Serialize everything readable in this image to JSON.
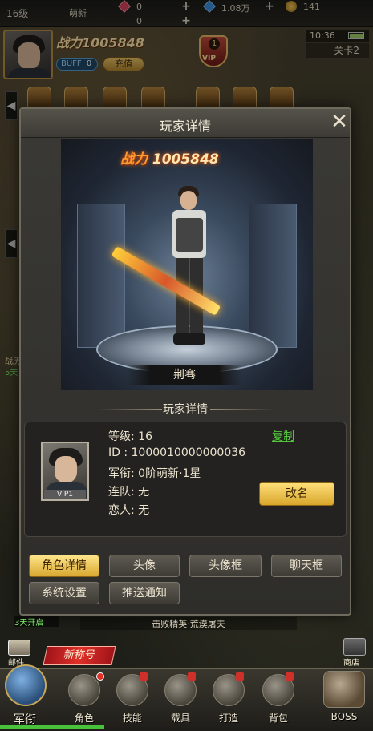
{
  "topbar": {
    "level": "16级",
    "rank": "萌新",
    "red_gems": "0",
    "red_gems_2": "0",
    "blue_gems": "1.08万",
    "coins": "141"
  },
  "player_header": {
    "power": "战力1005848",
    "buff_label": "BUFF",
    "buff_count": "0",
    "recharge_label": "充值",
    "vip_level": "1",
    "vip_label": "VIP",
    "clock": "10:36",
    "stage": "关卡2"
  },
  "side": {
    "left_label_1": "战历",
    "left_label_2": "5天"
  },
  "modal": {
    "title": "玩家详情",
    "power_prefix": "战力",
    "power_value": "1005848",
    "character_name": "荆骞",
    "section_title": "玩家详情",
    "portrait_vip": "VIP1",
    "info": {
      "level": "等级: 16",
      "id": "ID    : 1000010000000036",
      "rank": "军衔: 0阶萌新·1星",
      "team": "连队: 无",
      "lover": "恋人: 无"
    },
    "copy_label": "复制",
    "rename_label": "改名",
    "tabs": [
      {
        "label": "角色详情",
        "active": true
      },
      {
        "label": "头像",
        "active": false
      },
      {
        "label": "头像框",
        "active": false
      },
      {
        "label": "聊天框",
        "active": false
      },
      {
        "label": "系统设置",
        "active": false
      },
      {
        "label": "推送通知",
        "active": false
      }
    ]
  },
  "bottom": {
    "open_tag": "3天开启",
    "ticker": "击败精英·荒漠屠夫",
    "mail_label": "邮件",
    "shop_label": "商店",
    "new_title_label": "新称号"
  },
  "nav": {
    "items": [
      {
        "label": "军衔",
        "icon": "rank-medal-icon"
      },
      {
        "label": "角色",
        "icon": "character-icon"
      },
      {
        "label": "技能",
        "icon": "skill-icon"
      },
      {
        "label": "载具",
        "icon": "vehicle-icon"
      },
      {
        "label": "打造",
        "icon": "forge-icon"
      },
      {
        "label": "背包",
        "icon": "backpack-icon"
      },
      {
        "label": "BOSS",
        "icon": "boss-dragon-icon"
      }
    ]
  },
  "colors": {
    "accent_gold": "#d9a62c",
    "link_green": "#52c43a",
    "title_red": "#e03028"
  }
}
